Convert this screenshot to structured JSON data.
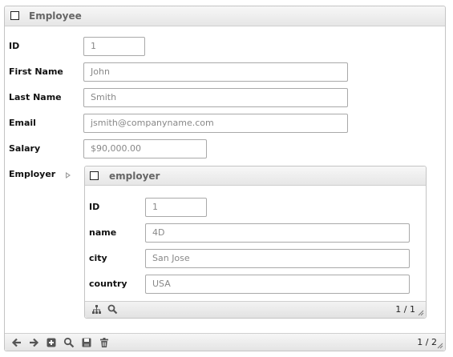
{
  "employee": {
    "title": "Employee",
    "fields": {
      "id": {
        "label": "ID",
        "value": "1"
      },
      "first_name": {
        "label": "First Name",
        "value": "John"
      },
      "last_name": {
        "label": "Last Name",
        "value": "Smith"
      },
      "email": {
        "label": "Email",
        "value": "jsmith@companyname.com"
      },
      "salary": {
        "label": "Salary",
        "value": "$90,000.00"
      },
      "employer": {
        "label": "Employer"
      }
    }
  },
  "employer": {
    "title": "employer",
    "fields": {
      "id": {
        "label": "ID",
        "value": "1"
      },
      "name": {
        "label": "name",
        "value": "4D"
      },
      "city": {
        "label": "city",
        "value": "San Jose"
      },
      "country": {
        "label": "country",
        "value": "USA"
      }
    },
    "footer": {
      "icons": [
        "tree-icon",
        "search-icon"
      ],
      "count": "1 / 1"
    }
  },
  "footer": {
    "icons": [
      "back-arrow-icon",
      "forward-arrow-icon",
      "add-icon",
      "search-icon",
      "save-icon",
      "trash-icon"
    ],
    "count": "1 / 2"
  }
}
